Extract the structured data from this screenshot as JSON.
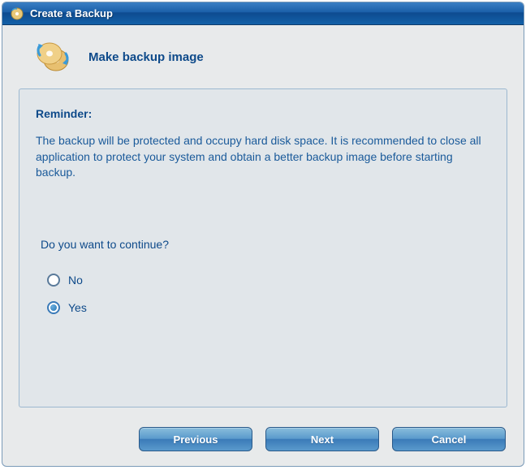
{
  "titlebar": {
    "title": "Create a Backup"
  },
  "header": {
    "heading": "Make backup image"
  },
  "panel": {
    "reminder_label": "Reminder:",
    "reminder_text": "The backup will be protected and occupy hard disk space. It is recommended to close all application to protect your system and obtain a better backup image before starting backup.",
    "continue_prompt": "Do you want to continue?",
    "options": {
      "no": "No",
      "yes": "Yes"
    },
    "selected": "yes"
  },
  "buttons": {
    "previous": "Previous",
    "next": "Next",
    "cancel": "Cancel"
  }
}
